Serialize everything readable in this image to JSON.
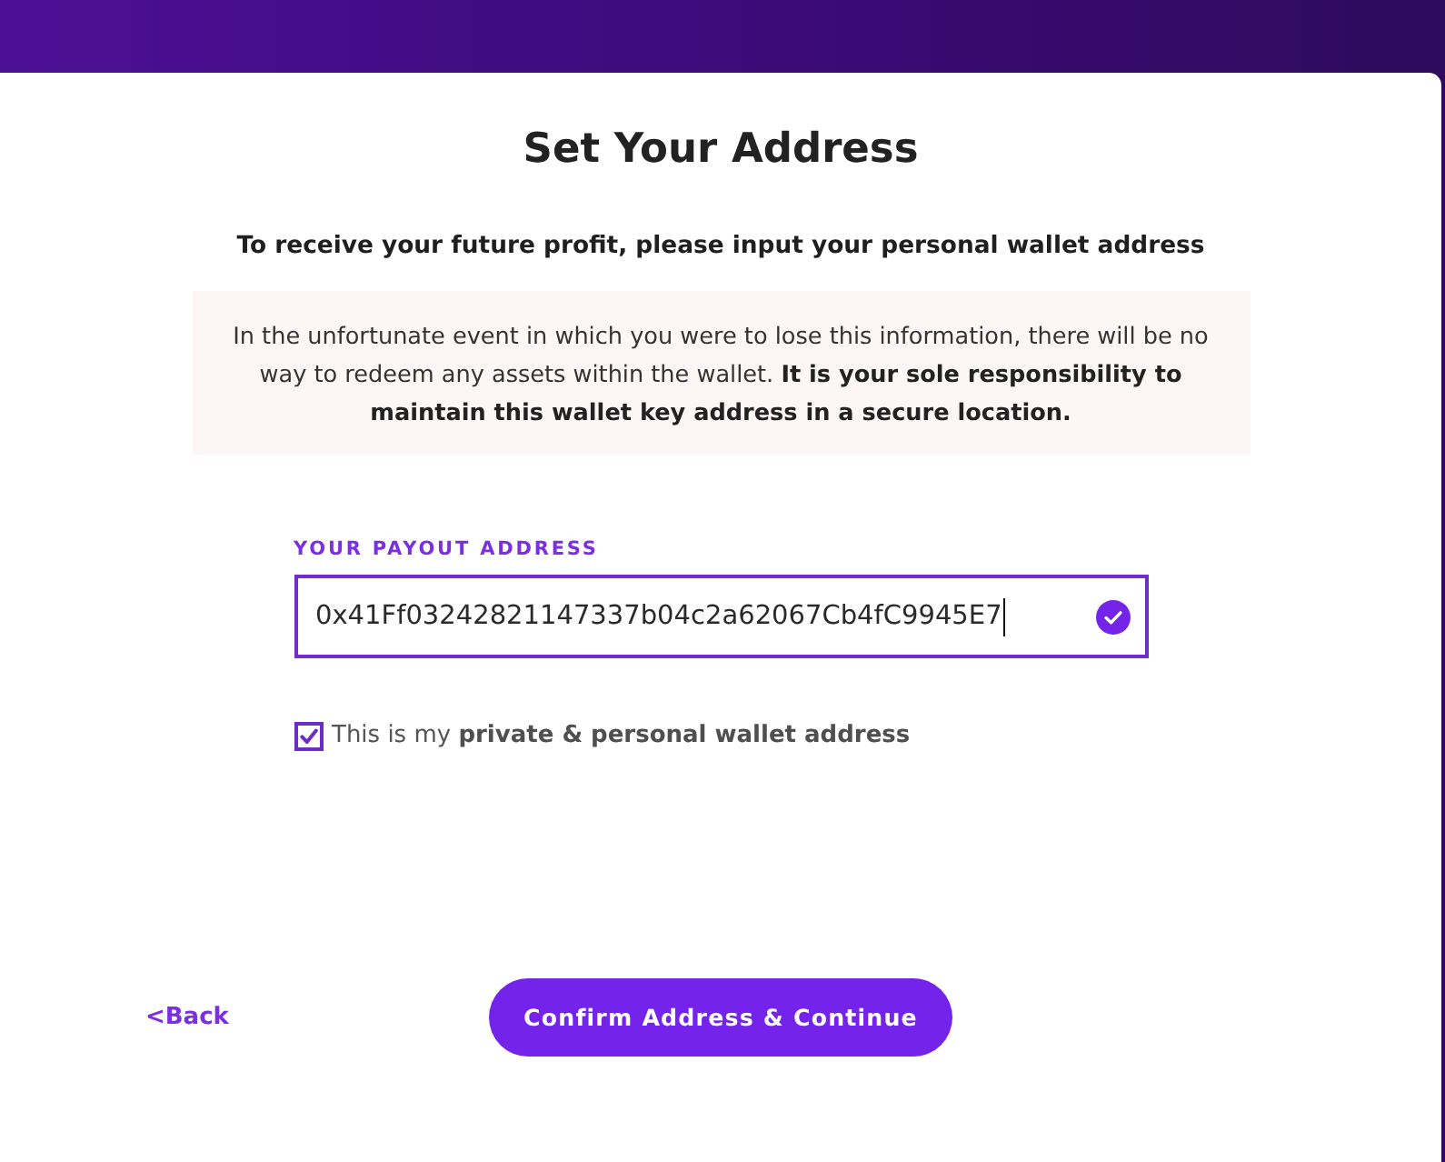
{
  "title": "Set Your Address",
  "subtitle": "To receive your future profit, please input your personal wallet address",
  "notice": "In the unfortunate event in which you were to lose this information, there will be no way to redeem any assets within the wallet. **It is your sole responsibility to maintain this wallet key address in a secure location.**",
  "payout_address": {
    "label": "YOUR PAYOUT ADDRESS",
    "value": "0x41Ff03242821147337b04c2a62067Cb4fC9945E7",
    "focused": true,
    "valid": true
  },
  "confirmation": {
    "label": "This is my **private & personal wallet address**",
    "checked": true
  },
  "back_link": "<Back",
  "buttons": [
    {
      "label": "Confirm Address & Continue",
      "kind": "primary"
    }
  ]
}
